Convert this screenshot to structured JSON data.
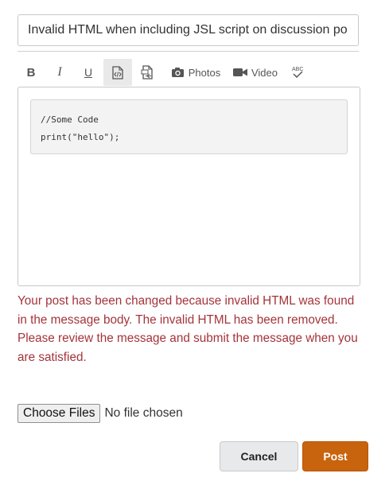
{
  "subject": {
    "value": "Invalid HTML when including JSL script on discussion po"
  },
  "toolbar": {
    "bold": "B",
    "italic": "I",
    "underline": "U",
    "photos_label": "Photos",
    "video_label": "Video",
    "spellcheck_label": "ABC"
  },
  "editor": {
    "code_lines": [
      "//Some Code",
      "print(\"hello\");"
    ]
  },
  "error_message": "Your post has been changed because invalid HTML was found in the message body. The invalid HTML has been removed. Please review the message and submit the message when you are satisfied.",
  "file_input": {
    "button_label": "Choose Files",
    "status": "No file chosen"
  },
  "actions": {
    "cancel_label": "Cancel",
    "post_label": "Post"
  },
  "colors": {
    "error": "#a4343a",
    "post_button": "#c8630e",
    "cancel_button": "#e8e9eb"
  }
}
